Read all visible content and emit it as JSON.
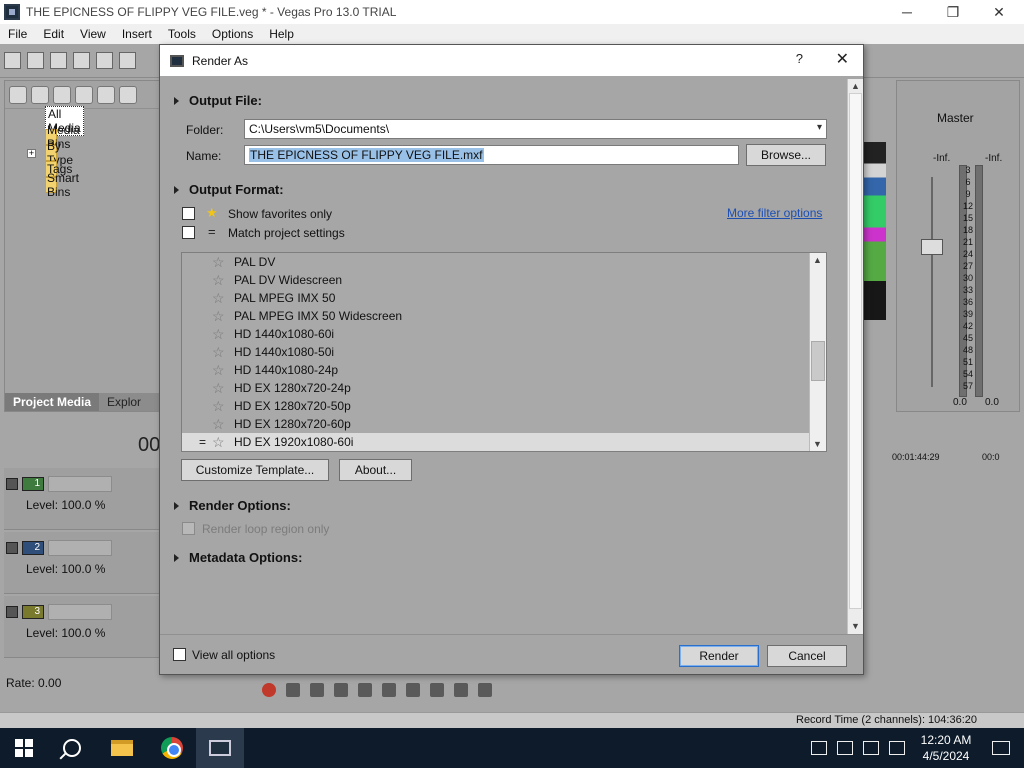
{
  "window": {
    "title": "THE EPICNESS OF FLIPPY VEG FILE.veg * - Vegas Pro 13.0 TRIAL",
    "controls": {
      "minimize": "─",
      "restore": "❐",
      "close": "✕"
    }
  },
  "menubar": [
    "File",
    "Edit",
    "View",
    "Insert",
    "Tools",
    "Options",
    "Help"
  ],
  "project_media": {
    "tree": [
      {
        "label": "All Media",
        "selected": true
      },
      {
        "label": "Media Bins"
      },
      {
        "label": "By Type",
        "expandable": "+"
      },
      {
        "label": "Tags"
      },
      {
        "label": "Smart Bins"
      }
    ],
    "tabs": [
      "Project Media",
      "Explor"
    ]
  },
  "timeline": {
    "timecode": "00",
    "tracks": [
      {
        "number": "1",
        "level": "Level: 100.0 %",
        "color": "#3f7a3f"
      },
      {
        "number": "2",
        "level": "Level: 100.0 %",
        "color": "#2f4f7a"
      },
      {
        "number": "3",
        "level": "Level: 100.0 %",
        "color": "#7a7a2f"
      }
    ],
    "rate": "Rate: 0.00",
    "ruler": {
      "mark1": "00:01:44:29",
      "mark2": "00:0"
    }
  },
  "master": {
    "label": "Master",
    "peak_left": "-Inf.",
    "peak_right": "-Inf.",
    "scale": [
      "3",
      "6",
      "9",
      "12",
      "15",
      "18",
      "21",
      "24",
      "27",
      "30",
      "33",
      "36",
      "39",
      "42",
      "45",
      "48",
      "51",
      "54",
      "57"
    ],
    "bottom_left": "0.0",
    "bottom_right": "0.0"
  },
  "status": {
    "record_time": "Record Time (2 channels): 104:36:20"
  },
  "taskbar": {
    "clock_time": "12:20 AM",
    "clock_date": "4/5/2024"
  },
  "dialog": {
    "title": "Render As",
    "help": "?",
    "close": "✕",
    "output_file": {
      "heading": "Output File:",
      "folder_label": "Folder:",
      "folder_value": "C:\\Users\\vm5\\Documents\\",
      "name_label": "Name:",
      "name_value": "THE EPICNESS OF FLIPPY VEG FILE.mxf",
      "browse_label": "Browse..."
    },
    "output_format": {
      "heading": "Output Format:",
      "show_favorites": "Show favorites only",
      "match_project": "Match project settings",
      "more_filter": "More filter options",
      "formats": [
        "PAL DV",
        "PAL DV Widescreen",
        "PAL MPEG IMX 50",
        "PAL MPEG IMX 50 Widescreen",
        "HD 1440x1080-60i",
        "HD 1440x1080-50i",
        "HD 1440x1080-24p",
        "HD EX 1280x720-24p",
        "HD EX 1280x720-50p",
        "HD EX 1280x720-60p",
        "HD EX 1920x1080-60i"
      ],
      "selected_format": "HD EX 1920x1080-60i",
      "customize_label": "Customize Template...",
      "about_label": "About..."
    },
    "render_options": {
      "heading": "Render Options:",
      "loop_region": "Render loop region only"
    },
    "metadata_options": {
      "heading": "Metadata Options:"
    },
    "footer": {
      "view_all": "View all options",
      "render_label": "Render",
      "cancel_label": "Cancel"
    }
  },
  "colors": {
    "selection_blue": "#99c1e8",
    "link_blue": "#1d4fb3",
    "dialog_bg": "#a6a6a6",
    "favorite_star": "#f0c419"
  }
}
